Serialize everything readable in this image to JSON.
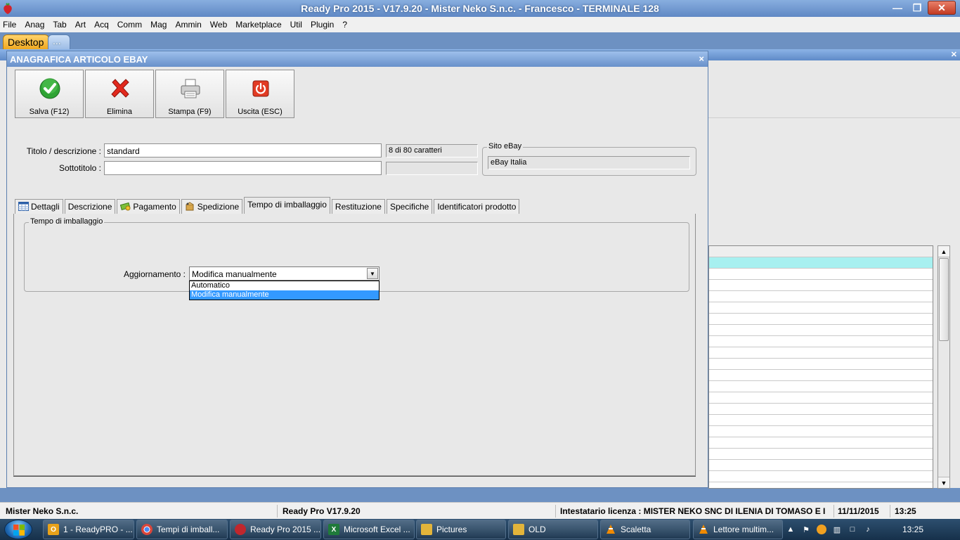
{
  "app": {
    "title": "Ready Pro 2015 - V17.9.20 - Mister Neko S.n.c. - Francesco - TERMINALE 128",
    "window_controls": [
      "minimize-icon",
      "restore-icon",
      "close-icon"
    ]
  },
  "menu": [
    "File",
    "Anag",
    "Tab",
    "Art",
    "Acq",
    "Comm",
    "Mag",
    "Ammin",
    "Web",
    "Marketplace",
    "Util",
    "Plugin",
    "?"
  ],
  "desktop_tabs": {
    "desktop": "Desktop",
    "more": "..."
  },
  "dialog": {
    "title": "ANAGRAFICA ARTICOLO EBAY",
    "close": "×",
    "toolbar": [
      {
        "label": "Salva (F12)",
        "icon": "checkmark-icon"
      },
      {
        "label": "Elimina",
        "icon": "delete-x-icon"
      },
      {
        "label": "Stampa (F9)",
        "icon": "printer-icon"
      },
      {
        "label": "Uscita (ESC)",
        "icon": "exit-power-icon"
      }
    ],
    "fields": {
      "title_label": "Titolo / descrizione :",
      "title_value": "standard",
      "title_counter": "8 di 80 caratteri",
      "subtitle_label": "Sottotitolo :",
      "subtitle_value": "",
      "subtitle_counter": ""
    },
    "site": {
      "group_label": "Sito eBay",
      "value": "eBay Italia"
    },
    "tabs": [
      {
        "label": "Dettagli",
        "icon": "calendar-grid-icon"
      },
      {
        "label": "Descrizione",
        "icon": ""
      },
      {
        "label": "Pagamento",
        "icon": "money-icon"
      },
      {
        "label": "Spedizione",
        "icon": "shipping-icon"
      },
      {
        "label": "Tempo di imballaggio",
        "icon": ""
      },
      {
        "label": "Restituzione",
        "icon": ""
      },
      {
        "label": "Specifiche",
        "icon": ""
      },
      {
        "label": "Identificatori prodotto",
        "icon": ""
      }
    ],
    "active_tab": "Tempo di imballaggio",
    "packaging": {
      "group_label": "Tempo di imballaggio",
      "update_label": "Aggiornamento :",
      "update_value": "Modifica manualmente",
      "options": [
        "Automatico",
        "Modifica manualmente"
      ],
      "selected_option": "Modifica manualmente"
    }
  },
  "statusbar": {
    "company": "Mister Neko S.n.c.",
    "version": "Ready Pro V17.9.20",
    "license": "Intestatario licenza : MISTER NEKO SNC DI ILENIA DI TOMASO E I",
    "date": "11/11/2015",
    "time": "13:25"
  },
  "taskbar": {
    "items": [
      {
        "label": "1 - ReadyPRO - ...",
        "icon": "outlook-icon",
        "color": "#e8a21a"
      },
      {
        "label": "Tempi di imball...",
        "icon": "chrome-icon",
        "color": "#d9463b"
      },
      {
        "label": "Ready Pro 2015 ...",
        "icon": "readypro-icon",
        "color": "#c0272d"
      },
      {
        "label": "Microsoft Excel ...",
        "icon": "excel-icon",
        "color": "#1f7a3a"
      },
      {
        "label": "Pictures",
        "icon": "folder-icon",
        "color": "#e3b43a"
      },
      {
        "label": "OLD",
        "icon": "folder-icon",
        "color": "#e3b43a"
      },
      {
        "label": "Scaletta",
        "icon": "vlc-icon",
        "color": "#f08a00"
      },
      {
        "label": "Lettore multim...",
        "icon": "vlc-icon",
        "color": "#f08a00"
      }
    ],
    "clock": "13:25"
  }
}
